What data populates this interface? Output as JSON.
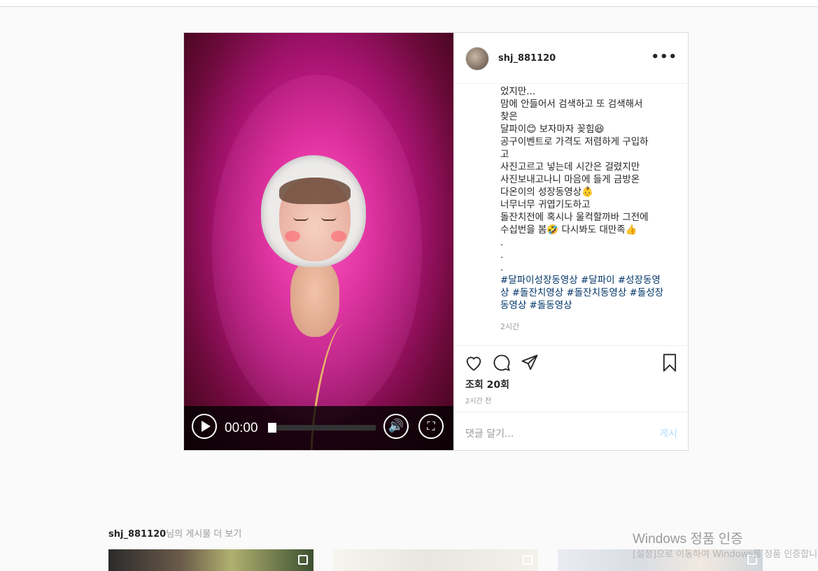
{
  "post": {
    "username": "shj_881120",
    "more_label": "•••",
    "caption_lines": [
      "었지만...",
      "맘에 안들어서 검색하고 또 검색해서",
      "찾은",
      "달파이😊 보자마자 꽂힘😆",
      "공구이벤트로 가격도 저렴하게 구입하",
      "고",
      "사진고르고 넣는데 시간은 걸렸지만",
      "사진보내고나니 마음에 들게 금방온",
      "다온이의 성장동영상👶",
      "너무너무 귀엽기도하고",
      "돌잔치전에 혹시나 울컥할까바 그전에",
      "수십번을 봄🤣 다시봐도 대만족👍",
      ".",
      ".",
      "."
    ],
    "hashtags": "#달파이성장동영상 #달파이 #성장동영상 #돌잔치영상 #돌잔치동영상 #돌성장동영상 #돌동영상",
    "caption_time": "2시간",
    "views": "조회 20회",
    "posted": "2시간 전",
    "comment_placeholder": "댓글 달기...",
    "post_button": "게시"
  },
  "video": {
    "time": "00:00",
    "progress": 0
  },
  "more_posts": {
    "username": "shj_881120",
    "suffix": "님의 게시물 더 보기"
  },
  "watermark": {
    "title": "Windows 정품 인증",
    "subtitle": "[설정]으로 이동하여 Windows를 정품 인증합니다."
  },
  "colors": {
    "link": "#003569",
    "post_button": "#b2dffc"
  }
}
